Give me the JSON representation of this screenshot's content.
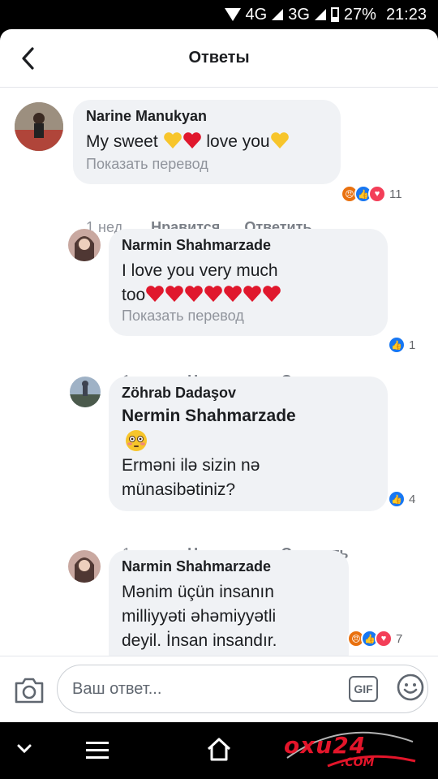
{
  "status": {
    "network1": "4G",
    "network2": "3G",
    "battery": "27%",
    "time": "21:23"
  },
  "header": {
    "title": "Ответы"
  },
  "comments": [
    {
      "author": "Narine Manukyan",
      "text_before": "My sweet",
      "text_after": "love you",
      "translate": "Показать перевод",
      "time": "1 нед.",
      "like": "Нравится",
      "reply": "Ответить",
      "reactions": [
        "angry",
        "like",
        "love"
      ],
      "reaction_count": "11"
    },
    {
      "author": "Narmin Shahmarzade",
      "text_line1": "I love you very much",
      "text_line2": "too",
      "hearts": 7,
      "translate": "Показать перевод",
      "time": "1 нед.",
      "like": "Нравится",
      "reply": "Ответить",
      "reactions": [
        "like"
      ],
      "reaction_count": "1"
    },
    {
      "author": "Zöhrab Dadaşov",
      "mention": "Nermin Shahmarzade",
      "text_line1": "Erməni ilə sizin nə",
      "text_line2": "münasibətiniz?",
      "time": "1 нед.",
      "like": "Нравится",
      "reply": "Ответить",
      "reactions": [
        "like"
      ],
      "reaction_count": "4"
    },
    {
      "author": "Narmin Shahmarzade",
      "text_line1": "Mənim üçün insanın",
      "text_line2": "milliyyəti əhəmiyyətli",
      "text_line3": "deyil. İnsan insandır.",
      "reactions": [
        "angry",
        "like",
        "love"
      ],
      "reaction_count": "7"
    }
  ],
  "reply_bar": {
    "placeholder": "Ваш ответ...",
    "gif_label": "GIF"
  },
  "watermark": {
    "main": "oxu24",
    "sub": ".COM"
  },
  "colors": {
    "like": "#1877f2",
    "love": "#f33e58",
    "angry": "#e9710f",
    "bubble": "#f0f2f5"
  }
}
